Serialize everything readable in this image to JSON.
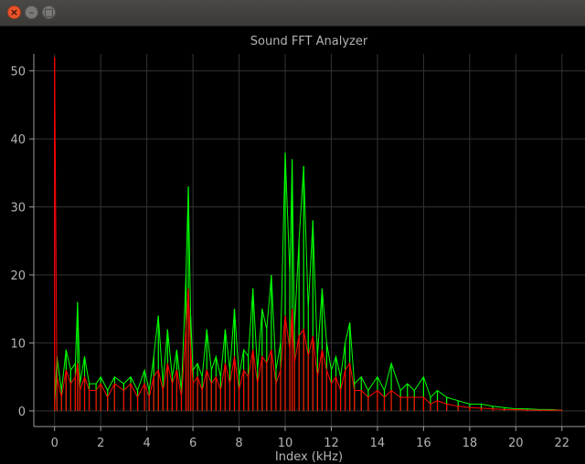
{
  "window": {
    "close_glyph": "×",
    "min_glyph": "–",
    "max_glyph": "□"
  },
  "colors": {
    "background": "#000000",
    "grid": "#333333",
    "axis": "#9a9a9a",
    "text": "#b4b4b4",
    "series_green": "#00ff00",
    "series_red": "#ff0000"
  },
  "chart_data": {
    "type": "line",
    "title": "Sound FFT Analyzer",
    "xlabel": "Index (kHz)",
    "ylabel": "",
    "xlim": [
      -0.9,
      23
    ],
    "ylim": [
      -2.3,
      52.5
    ],
    "xticks": [
      "0",
      "2",
      "4",
      "6",
      "8",
      "10",
      "12",
      "14",
      "16",
      "18",
      "20",
      "22"
    ],
    "yticks": [
      "0",
      "10",
      "20",
      "30",
      "40",
      "50"
    ],
    "grid": true,
    "legend": "none",
    "series": [
      {
        "color": "#00ff00",
        "x": [
          0,
          0.1,
          0.3,
          0.5,
          0.7,
          0.9,
          1.0,
          1.1,
          1.3,
          1.5,
          1.8,
          2.0,
          2.3,
          2.6,
          3.0,
          3.3,
          3.6,
          3.9,
          4.1,
          4.3,
          4.5,
          4.7,
          4.9,
          5.1,
          5.3,
          5.5,
          5.7,
          5.8,
          5.9,
          6.0,
          6.2,
          6.4,
          6.6,
          6.8,
          7.0,
          7.2,
          7.4,
          7.6,
          7.8,
          8.0,
          8.2,
          8.4,
          8.6,
          8.8,
          9.0,
          9.2,
          9.4,
          9.6,
          9.8,
          10.0,
          10.2,
          10.3,
          10.4,
          10.6,
          10.8,
          11.0,
          11.2,
          11.4,
          11.6,
          11.8,
          12.0,
          12.2,
          12.4,
          12.6,
          12.8,
          13.0,
          13.3,
          13.6,
          14.0,
          14.3,
          14.6,
          15.0,
          15.3,
          15.6,
          16.0,
          16.3,
          16.6,
          17.0,
          17.5,
          18.0,
          18.5,
          19.0,
          19.5,
          20.0,
          20.5,
          21.0,
          21.5,
          22.0
        ],
        "values": [
          0.5,
          8,
          3,
          9,
          6,
          7,
          16,
          4,
          8,
          4,
          4,
          5,
          3,
          5,
          4,
          5,
          3,
          6,
          3,
          8,
          14,
          4,
          12,
          5,
          9,
          3,
          20,
          33,
          14,
          6,
          7,
          5,
          12,
          6,
          8,
          5,
          12,
          6,
          15,
          5,
          9,
          8,
          18,
          6,
          15,
          12,
          20,
          6,
          10,
          38,
          20,
          37,
          12,
          25,
          36,
          15,
          28,
          8,
          18,
          10,
          6,
          8,
          5,
          10,
          13,
          4,
          5,
          3,
          5,
          3,
          7,
          3,
          4,
          3,
          5,
          2,
          3,
          2,
          1.5,
          1,
          1,
          0.7,
          0.5,
          0.3,
          0.3,
          0.2,
          0.2,
          0.1
        ]
      },
      {
        "color": "#ff0000",
        "x": [
          0,
          0.1,
          0.3,
          0.5,
          0.7,
          0.9,
          1.0,
          1.1,
          1.3,
          1.5,
          1.8,
          2.0,
          2.3,
          2.6,
          3.0,
          3.3,
          3.6,
          3.9,
          4.1,
          4.3,
          4.5,
          4.7,
          4.9,
          5.1,
          5.3,
          5.5,
          5.7,
          5.8,
          5.9,
          6.0,
          6.2,
          6.4,
          6.6,
          6.8,
          7.0,
          7.2,
          7.4,
          7.6,
          7.8,
          8.0,
          8.2,
          8.4,
          8.6,
          8.8,
          9.0,
          9.2,
          9.4,
          9.6,
          9.8,
          10.0,
          10.2,
          10.3,
          10.4,
          10.6,
          10.8,
          11.0,
          11.2,
          11.4,
          11.6,
          11.8,
          12.0,
          12.2,
          12.4,
          12.6,
          12.8,
          13.0,
          13.3,
          13.6,
          14.0,
          14.3,
          14.6,
          15.0,
          15.3,
          15.6,
          16.0,
          16.3,
          16.6,
          17.0,
          17.5,
          18.0,
          18.5,
          19.0,
          19.5,
          20.0,
          20.5,
          21.0,
          21.5,
          22.0
        ],
        "values": [
          52,
          5,
          2,
          6,
          4,
          5,
          7,
          3,
          5,
          3,
          3,
          4,
          2,
          4,
          3,
          4,
          2,
          4,
          2,
          5,
          6,
          3,
          7,
          4,
          6,
          2,
          12,
          18,
          9,
          4,
          5,
          3,
          6,
          4,
          5,
          3,
          7,
          4,
          8,
          3,
          6,
          5,
          9,
          4,
          8,
          7,
          9,
          4,
          6,
          14,
          9,
          15,
          7,
          11,
          12,
          8,
          11,
          5,
          9,
          6,
          4,
          5,
          3,
          6,
          7,
          3,
          3,
          2,
          3,
          2,
          3,
          2,
          2,
          2,
          2,
          1,
          1.5,
          1,
          0.7,
          0.5,
          0.4,
          0.3,
          0.2,
          0.2,
          0.1,
          0.1,
          0.1,
          0.1
        ]
      }
    ]
  }
}
